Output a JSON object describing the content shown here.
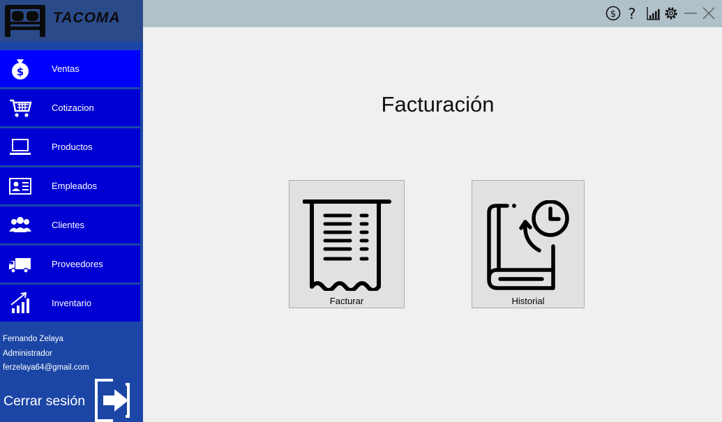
{
  "brand": {
    "name": "TACOMA",
    "logo_icon": "bed-icon"
  },
  "window_controls": [
    {
      "name": "currency-icon"
    },
    {
      "name": "help-icon"
    },
    {
      "name": "chart-icon"
    },
    {
      "name": "gear-icon"
    },
    {
      "name": "minimize-icon"
    },
    {
      "name": "close-icon"
    }
  ],
  "sidebar": {
    "items": [
      {
        "label": "Ventas",
        "icon": "money-bag-icon",
        "active": true
      },
      {
        "label": "Cotizacion",
        "icon": "cart-icon"
      },
      {
        "label": "Productos",
        "icon": "laptop-icon"
      },
      {
        "label": "Empleados",
        "icon": "id-card-icon"
      },
      {
        "label": "Clientes",
        "icon": "users-icon"
      },
      {
        "label": "Proveedores",
        "icon": "truck-icon"
      },
      {
        "label": "Inventario",
        "icon": "growth-chart-icon"
      }
    ]
  },
  "user": {
    "name": "Fernando Zelaya",
    "role": "Administrador",
    "email": "ferzelaya64@gmail.com"
  },
  "logout": {
    "label": "Cerrar sesión",
    "icon": "logout-arrow-icon"
  },
  "main": {
    "title": "Facturación",
    "tiles": [
      {
        "label": "Facturar",
        "icon": "receipt-icon"
      },
      {
        "label": "Historial",
        "icon": "history-book-icon"
      }
    ]
  },
  "colors": {
    "sidebar": "#1b46a6",
    "nav_item": "#0000d2",
    "nav_active": "#0000ff",
    "topbar": "#b1c1c9",
    "content_bg": "#f0f0f0"
  }
}
